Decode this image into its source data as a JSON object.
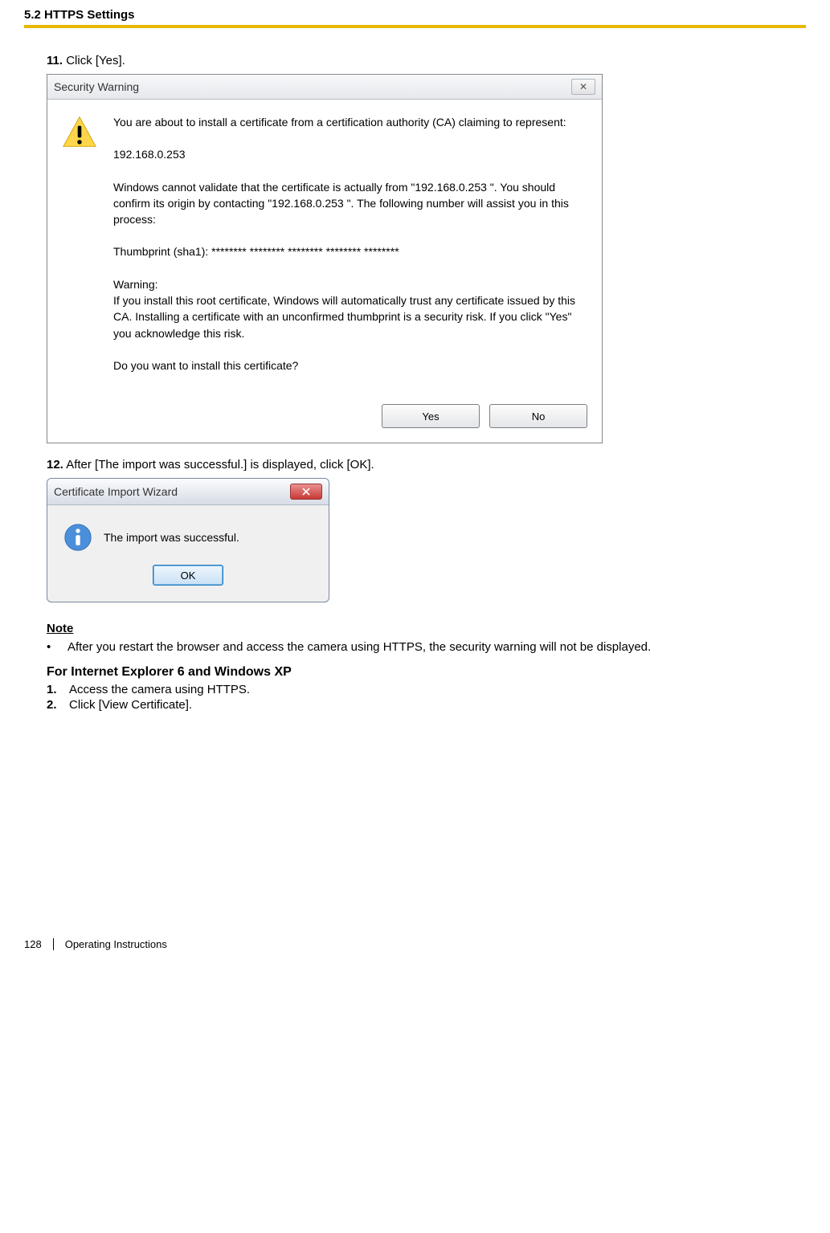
{
  "header": {
    "section_title": "5.2 HTTPS Settings"
  },
  "steps": {
    "s11_num": "11.",
    "s11_text": "Click [Yes].",
    "s12_num": "12.",
    "s12_text": "After [The import was successful.] is displayed, click [OK]."
  },
  "dialog_warning": {
    "title": "Security Warning",
    "close_label": "✕",
    "para1": "You are about to install a certificate from a certification authority (CA) claiming to represent:",
    "address": "192.168.0.253",
    "para2": "Windows cannot validate that the certificate is actually from \"192.168.0.253 \". You should confirm its origin by contacting \"192.168.0.253 \". The following number will assist you in this process:",
    "thumb": "Thumbprint (sha1): ******** ******** ******** ******** ********",
    "warn_label": "Warning:",
    "warn_body": "If you install this root certificate, Windows will automatically trust any certificate issued by this CA. Installing a certificate with an unconfirmed thumbprint is a security risk. If you click \"Yes\" you acknowledge this risk.",
    "question": "Do you want to install this certificate?",
    "yes": "Yes",
    "no": "No"
  },
  "dialog_info": {
    "title": "Certificate Import Wizard",
    "message": "The import was successful.",
    "ok": "OK"
  },
  "note": {
    "heading": "Note",
    "bullet": "•",
    "text": "After you restart the browser and access the camera using HTTPS, the security warning will not be displayed."
  },
  "subsection": {
    "title": "For Internet Explorer 6 and Windows XP",
    "n1_num": "1.",
    "n1_text": "Access the camera using HTTPS.",
    "n2_num": "2.",
    "n2_text": "Click [View Certificate]."
  },
  "footer": {
    "page_number": "128",
    "doc_title": "Operating Instructions"
  }
}
